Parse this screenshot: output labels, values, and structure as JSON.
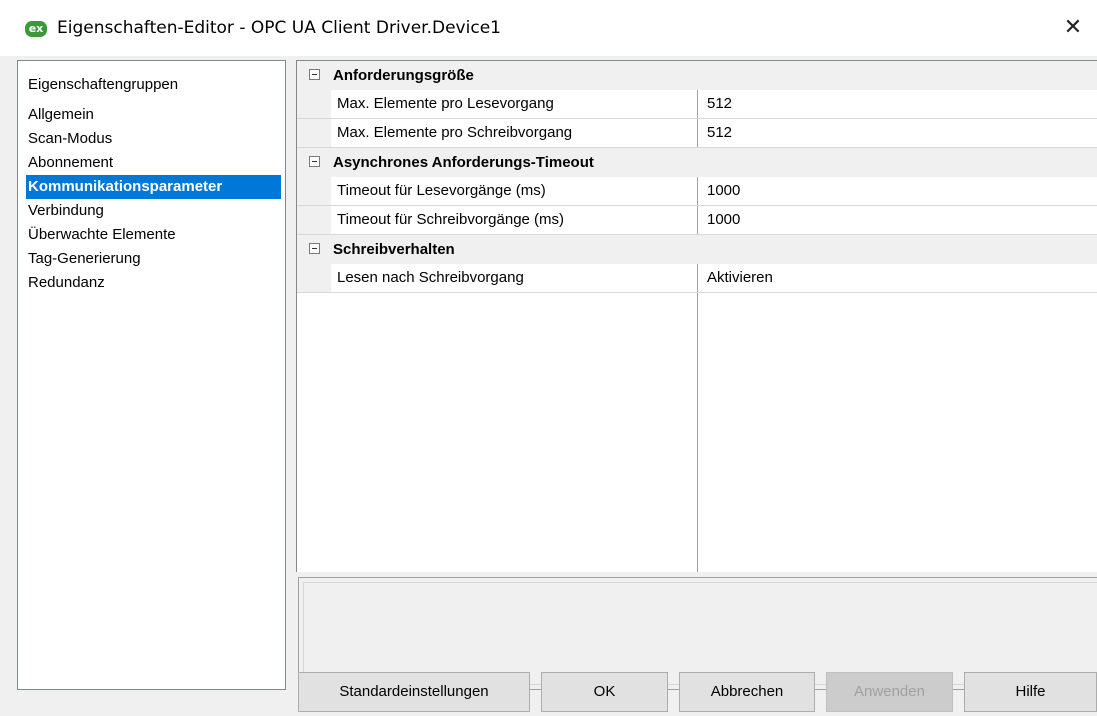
{
  "window": {
    "title": "Eigenschaften-Editor - OPC UA Client Driver.Device1",
    "app_icon_text": "ex",
    "close_symbol": "✕"
  },
  "groups": {
    "header": "Eigenschaftengruppen",
    "items": [
      {
        "label": "Allgemein",
        "selected": false
      },
      {
        "label": "Scan-Modus",
        "selected": false
      },
      {
        "label": "Abonnement",
        "selected": false
      },
      {
        "label": "Kommunikationsparameter",
        "selected": true
      },
      {
        "label": "Verbindung",
        "selected": false
      },
      {
        "label": "Überwachte Elemente",
        "selected": false
      },
      {
        "label": "Tag-Generierung",
        "selected": false
      },
      {
        "label": "Redundanz",
        "selected": false
      }
    ]
  },
  "property_grid": {
    "categories": [
      {
        "label": "Anforderungsgröße",
        "properties": [
          {
            "name": "Max. Elemente pro Lesevorgang",
            "value": "512"
          },
          {
            "name": "Max. Elemente pro Schreibvorgang",
            "value": "512"
          }
        ]
      },
      {
        "label": "Asynchrones Anforderungs-Timeout",
        "properties": [
          {
            "name": "Timeout für Lesevorgänge (ms)",
            "value": "1000"
          },
          {
            "name": "Timeout für Schreibvorgänge (ms)",
            "value": "1000"
          }
        ]
      },
      {
        "label": "Schreibverhalten",
        "properties": [
          {
            "name": "Lesen nach Schreibvorgang",
            "value": "Aktivieren"
          }
        ]
      }
    ]
  },
  "buttons": {
    "defaults": "Standardeinstellungen",
    "ok": "OK",
    "cancel": "Abbrechen",
    "apply": "Anwenden",
    "help": "Hilfe"
  },
  "colors": {
    "selection": "#0078d7",
    "app_icon": "#3a9a3a"
  }
}
